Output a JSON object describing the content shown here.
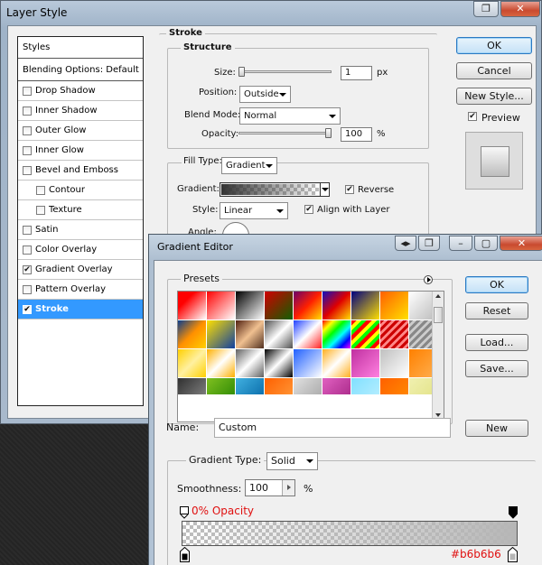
{
  "layer_style": {
    "title": "Layer Style",
    "styles_header": "Styles",
    "blending_options": "Blending Options: Default",
    "effects": [
      {
        "label": "Drop Shadow",
        "checked": false,
        "indent": false
      },
      {
        "label": "Inner Shadow",
        "checked": false,
        "indent": false
      },
      {
        "label": "Outer Glow",
        "checked": false,
        "indent": false
      },
      {
        "label": "Inner Glow",
        "checked": false,
        "indent": false
      },
      {
        "label": "Bevel and Emboss",
        "checked": false,
        "indent": false
      },
      {
        "label": "Contour",
        "checked": false,
        "indent": true
      },
      {
        "label": "Texture",
        "checked": false,
        "indent": true
      },
      {
        "label": "Satin",
        "checked": false,
        "indent": false
      },
      {
        "label": "Color Overlay",
        "checked": false,
        "indent": false
      },
      {
        "label": "Gradient Overlay",
        "checked": true,
        "indent": false
      },
      {
        "label": "Pattern Overlay",
        "checked": false,
        "indent": false
      },
      {
        "label": "Stroke",
        "checked": true,
        "indent": false
      }
    ],
    "stroke": {
      "group_label": "Stroke",
      "structure_label": "Structure",
      "size_label": "Size:",
      "size_value": "1",
      "size_unit": "px",
      "position_label": "Position:",
      "position_value": "Outside",
      "blend_mode_label": "Blend Mode:",
      "blend_mode_value": "Normal",
      "opacity_label": "Opacity:",
      "opacity_value": "100",
      "opacity_unit": "%",
      "fill_type_label": "Fill Type:",
      "fill_type_value": "Gradient",
      "gradient_label": "Gradient:",
      "reverse_label": "Reverse",
      "reverse_checked": true,
      "style_label": "Style:",
      "style_value": "Linear",
      "align_label": "Align with Layer",
      "align_checked": true,
      "angle_label": "Angle:"
    },
    "buttons": {
      "ok": "OK",
      "cancel": "Cancel",
      "new_style": "New Style...",
      "preview_label": "Preview",
      "preview_checked": true
    }
  },
  "gradient_editor": {
    "title": "Gradient Editor",
    "presets_label": "Presets",
    "name_label": "Name:",
    "name_value": "Custom",
    "buttons": {
      "ok": "OK",
      "reset": "Reset",
      "load": "Load...",
      "save": "Save...",
      "new": "New"
    },
    "gradient_type_label": "Gradient Type:",
    "gradient_type_value": "Solid",
    "smoothness_label": "Smoothness:",
    "smoothness_value": "100",
    "smoothness_unit": "%",
    "opacity_annotation": "0% Opacity",
    "color_annotation": "#b6b6b6",
    "annotation_color": "#e01010",
    "end_color": "#b6b6b6"
  }
}
